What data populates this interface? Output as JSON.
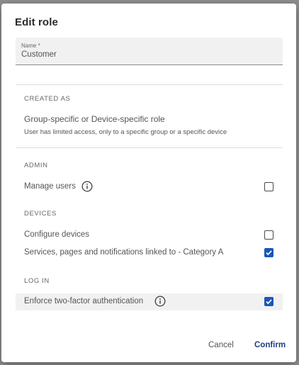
{
  "dialog": {
    "title": "Edit role",
    "name_field": {
      "label": "Name *",
      "value": "Customer"
    },
    "created_as": {
      "header": "CREATED AS",
      "title": "Group-specific or Device-specific role",
      "description": "User has limited access, only to a specific group or a specific device"
    },
    "admin": {
      "header": "ADMIN",
      "items": [
        {
          "label": "Manage users",
          "checked": false,
          "info_icon": "info-icon"
        }
      ]
    },
    "devices": {
      "header": "DEVICES",
      "items": [
        {
          "label": "Configure devices",
          "checked": false
        },
        {
          "label": "Services, pages and notifications linked to - Category A",
          "checked": true
        }
      ]
    },
    "log_in": {
      "header": "LOG IN",
      "items": [
        {
          "label": "Enforce two-factor authentication",
          "checked": true,
          "info_icon": "info-icon"
        }
      ]
    },
    "buttons": {
      "cancel": "Cancel",
      "confirm": "Confirm"
    },
    "colors": {
      "accent": "#1a56b8",
      "confirm_text": "#1c3f82"
    }
  }
}
